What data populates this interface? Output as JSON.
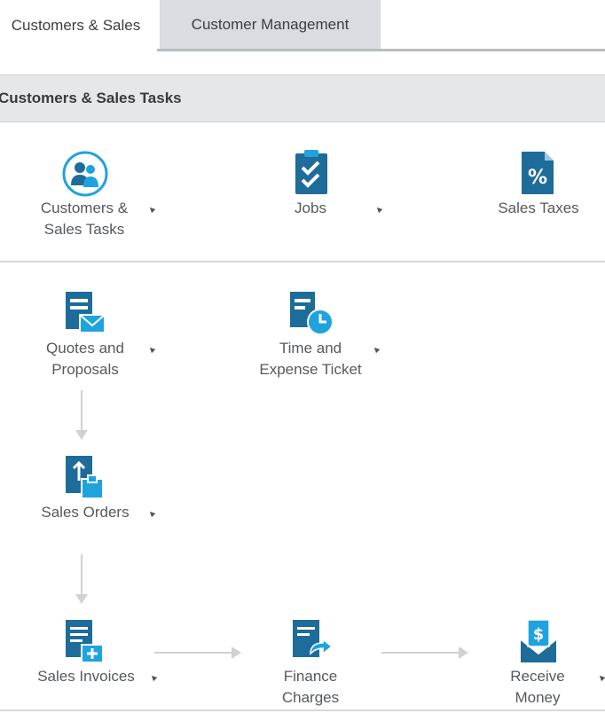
{
  "tabs": [
    {
      "label": "Customers & Sales",
      "active": true
    },
    {
      "label": "Customer Management",
      "active": false
    }
  ],
  "section": {
    "title": "Customers & Sales Tasks"
  },
  "tasks": {
    "customers_sales_tasks": {
      "line1": "Customers &",
      "line2": "Sales Tasks",
      "icon": "people-icon"
    },
    "jobs": {
      "line1": "Jobs",
      "icon": "clipboard-check-icon"
    },
    "sales_taxes": {
      "line1": "Sales Taxes",
      "icon": "percent-document-icon"
    },
    "quotes_proposals": {
      "line1": "Quotes and",
      "line2": "Proposals",
      "icon": "document-envelope-icon"
    },
    "time_expense": {
      "line1": "Time and",
      "line2": "Expense  Ticket",
      "icon": "document-clock-icon"
    },
    "sales_orders": {
      "line1": "Sales Orders",
      "icon": "document-upload-icon"
    },
    "sales_invoices": {
      "line1": "Sales Invoices",
      "icon": "invoice-icon"
    },
    "finance_charges": {
      "line1": "Finance",
      "line2": "Charges",
      "icon": "document-return-icon"
    },
    "receive_money": {
      "line1": "Receive",
      "line2": "Money",
      "icon": "money-envelope-icon"
    }
  },
  "colors": {
    "icon_primary": "#1e6c99",
    "icon_accent": "#1ea3df",
    "icon_light": "#9fc8e8"
  }
}
